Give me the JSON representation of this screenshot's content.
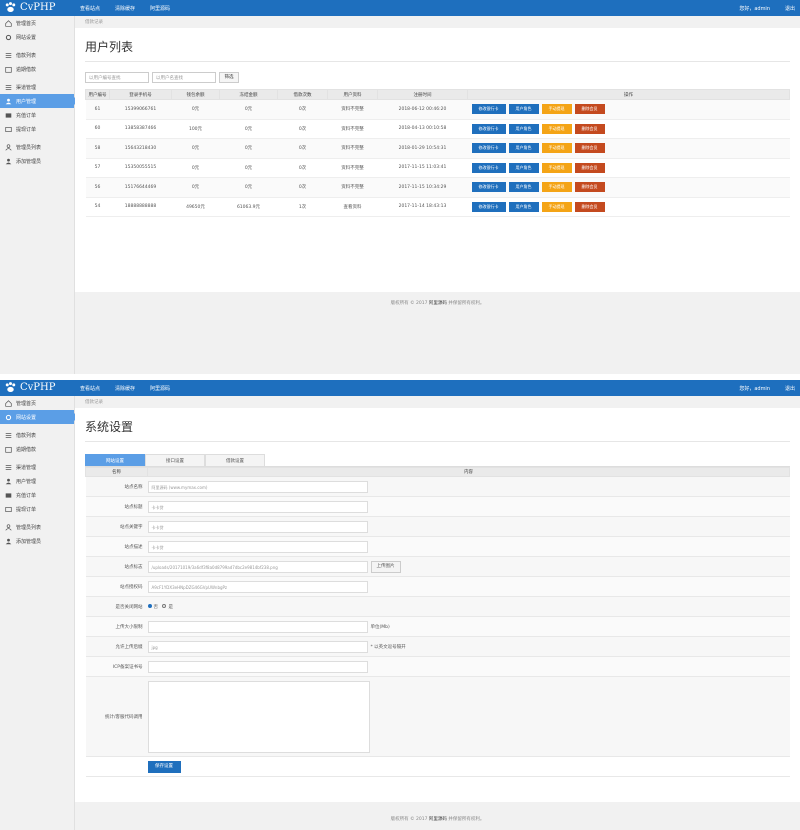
{
  "brand": {
    "name": "CvPHP"
  },
  "topnav": {
    "items": [
      {
        "label": "查看站点"
      },
      {
        "label": "清除缓存"
      },
      {
        "label": "阿里源码"
      }
    ]
  },
  "user": {
    "greeting": "您好，admin",
    "logout": "退出"
  },
  "sidebar_users": {
    "items": [
      {
        "label": "管理首页",
        "icon": "home-icon"
      },
      {
        "label": "网站设置",
        "icon": "gear-icon"
      },
      {
        "label": "借款列表",
        "icon": "list-icon"
      },
      {
        "label": "逾期借款",
        "icon": "calendar-icon"
      },
      {
        "label": "渠道管理",
        "icon": "list-icon"
      },
      {
        "label": "用户管理",
        "icon": "user-icon",
        "active": true
      },
      {
        "label": "充值订单",
        "icon": "wallet-icon"
      },
      {
        "label": "提现订单",
        "icon": "card-icon"
      },
      {
        "label": "管理员列表",
        "icon": "admin-icon"
      },
      {
        "label": "添加管理员",
        "icon": "user-add-icon"
      }
    ]
  },
  "sidebar_settings": {
    "items": [
      {
        "label": "管理首页",
        "icon": "home-icon"
      },
      {
        "label": "网站设置",
        "icon": "gear-icon",
        "active": true
      },
      {
        "label": "借款列表",
        "icon": "list-icon"
      },
      {
        "label": "逾期借款",
        "icon": "calendar-icon"
      },
      {
        "label": "渠道管理",
        "icon": "list-icon"
      },
      {
        "label": "用户管理",
        "icon": "user-icon"
      },
      {
        "label": "充值订单",
        "icon": "wallet-icon"
      },
      {
        "label": "提现订单",
        "icon": "card-icon"
      },
      {
        "label": "管理员列表",
        "icon": "admin-icon"
      },
      {
        "label": "添加管理员",
        "icon": "user-add-icon"
      }
    ]
  },
  "users_page": {
    "breadcrumb": "借款记录",
    "title": "用户列表",
    "search": {
      "user_id_placeholder": "以用户编号查找",
      "user_name_placeholder": "以用户名查找",
      "button": "筛选"
    },
    "columns": [
      "用户编号",
      "登录手机号",
      "钱包余额",
      "冻结金额",
      "借款次数",
      "用户资料",
      "注册时间",
      "操作"
    ],
    "actions": [
      "修改银行卡",
      "用户角色",
      "手动提现",
      "删除会员"
    ],
    "rows": [
      [
        "61",
        "15399066761",
        "0元",
        "0元",
        "0次",
        "资料不完整",
        "2018-06-12 00:46:20"
      ],
      [
        "60",
        "13858387466",
        "100元",
        "0元",
        "0次",
        "资料不完整",
        "2018-04-13 00:10:58"
      ],
      [
        "58",
        "15643218430",
        "0元",
        "0元",
        "0次",
        "资料不完整",
        "2018-01-29 10:54:31"
      ],
      [
        "57",
        "15350055515",
        "0元",
        "0元",
        "0次",
        "资料不完整",
        "2017-11-15 11:03:41"
      ],
      [
        "56",
        "15176644469",
        "0元",
        "0元",
        "0次",
        "资料不完整",
        "2017-11-15 10:34:29"
      ],
      [
        "54",
        "18888888888",
        "49650元",
        "61063.9元",
        "1次",
        "查看资料",
        "2017-11-14 18:43:13"
      ]
    ]
  },
  "footer": {
    "prefix": "版权所有 © 2017",
    "brand": "阿里源码",
    "suffix": "并保留所有权利。"
  },
  "settings_page": {
    "breadcrumb": "借款记录",
    "title": "系统设置",
    "tabs": [
      "网站设置",
      "接口设置",
      "借款设置"
    ],
    "col_name": "名称",
    "col_content": "内容",
    "fields": {
      "site_name": {
        "label": "站点名称",
        "value": "阿里源码 (www.mymax.com)"
      },
      "site_title": {
        "label": "站点标题",
        "value": "卡卡贷"
      },
      "keywords": {
        "label": "站点关键字",
        "value": "卡卡贷"
      },
      "description": {
        "label": "站点描述",
        "value": "卡卡贷"
      },
      "logo": {
        "label": "站点标志",
        "value": "/uploads/20171019/3a6df3f8a0d8799ad7dbc2e9814bf238.png",
        "button": "上传图片"
      },
      "license": {
        "label": "站点授权码",
        "value": "A9cF1YDX3eHNpDZG46GVpUWnbgPz"
      },
      "close_site": {
        "label": "是否关闭网站",
        "yes": "否",
        "no": "是"
      },
      "upload_limit": {
        "label": "上传大小限制",
        "hint": "单位(Mb)"
      },
      "upload_types": {
        "label": "允许上传后缀",
        "value": "jpg",
        "hint": "* 以英文逗号隔开"
      },
      "icp": {
        "label": "ICP备案证书号"
      },
      "stats": {
        "label": "统计/客服代码调用"
      }
    },
    "save": "保存设置"
  }
}
